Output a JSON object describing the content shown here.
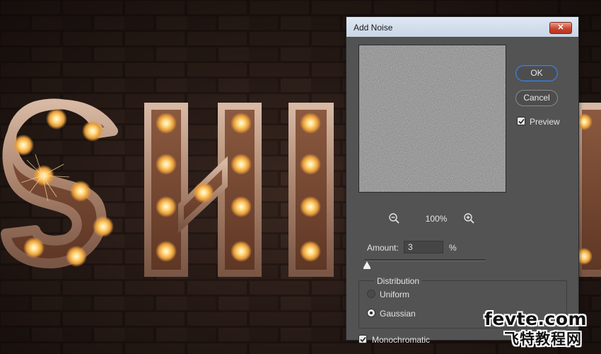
{
  "dialog": {
    "title": "Add Noise",
    "close_label": "✕",
    "ok_label": "OK",
    "cancel_label": "Cancel",
    "preview_label": "Preview",
    "preview_checked": true,
    "zoom_level": "100%",
    "amount_label": "Amount:",
    "amount_value": "3",
    "amount_unit": "%",
    "amount_fraction": 0.0075,
    "distribution": {
      "legend": "Distribution",
      "options": [
        "Uniform",
        "Gaussian"
      ],
      "selected": "Gaussian"
    },
    "monochromatic_label": "Monochromatic",
    "monochromatic_checked": true
  },
  "canvas": {
    "visible_letters": [
      "S",
      "H",
      "I"
    ]
  },
  "watermark": {
    "line1": "fevte.com",
    "line2": "飞特教程网"
  },
  "icons": [
    "close-icon",
    "zoom-out-icon",
    "zoom-in-icon",
    "checkmark-icon"
  ],
  "colors": {
    "dialog_bg": "#535353",
    "ok_border": "#4b7fc7",
    "close_red": "#c9462f",
    "bulb_glow": "#ffc85a"
  }
}
